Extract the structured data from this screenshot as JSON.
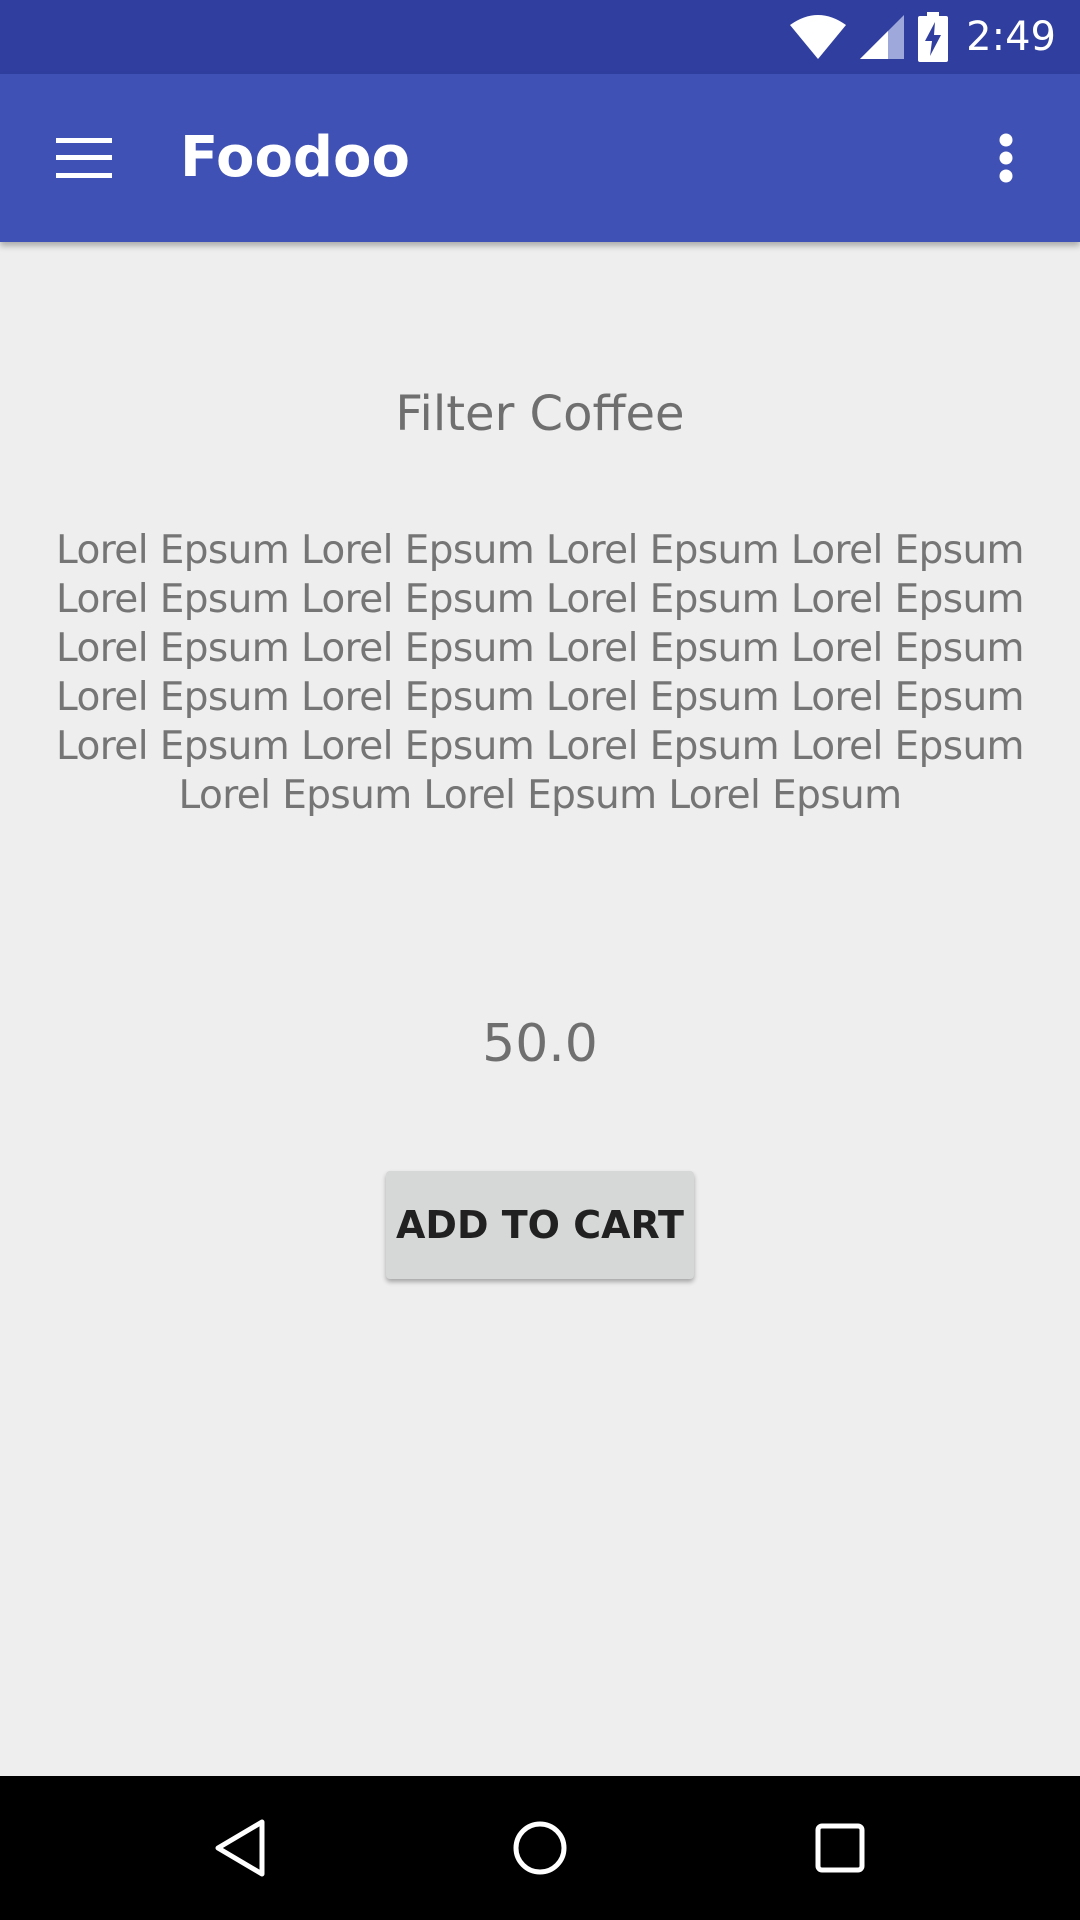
{
  "status_bar": {
    "time": "2:49",
    "icons": [
      "wifi-icon",
      "signal-icon",
      "battery-charging-icon"
    ],
    "background": "#303f9f"
  },
  "app_bar": {
    "title": "Foodoo",
    "menu_icon": "hamburger-menu-icon",
    "overflow_icon": "more-vert-icon",
    "background": "#3f51b5"
  },
  "product": {
    "name": "Filter Coffee",
    "description": "Lorel Epsum Lorel Epsum Lorel Epsum Lorel Epsum Lorel Epsum Lorel Epsum Lorel Epsum Lorel Epsum Lorel Epsum Lorel Epsum Lorel Epsum Lorel Epsum Lorel Epsum Lorel Epsum Lorel Epsum Lorel Epsum Lorel Epsum Lorel Epsum Lorel Epsum Lorel Epsum Lorel Epsum Lorel Epsum Lorel Epsum",
    "price": "50.0",
    "add_to_cart_label": "ADD TO CART"
  },
  "nav_bar": {
    "icons": [
      "back-icon",
      "home-icon",
      "recents-icon"
    ]
  },
  "colors": {
    "background": "#eeeeee",
    "text_secondary": "#757575",
    "button_bg": "#d6d7d7"
  }
}
